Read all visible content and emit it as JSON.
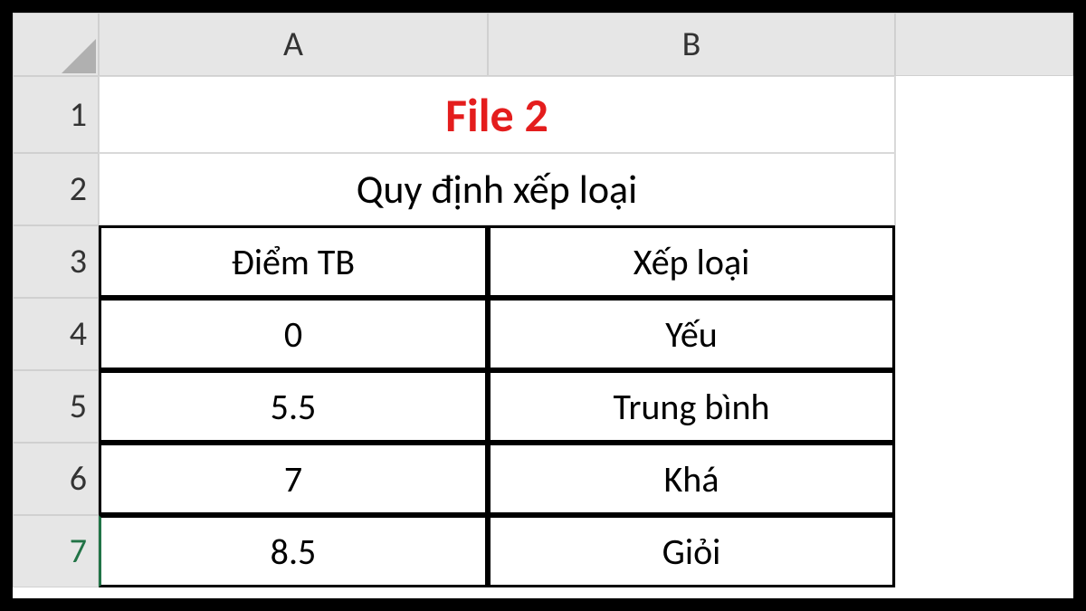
{
  "columns": {
    "a": "A",
    "b": "B"
  },
  "rows": {
    "r1": "1",
    "r2": "2",
    "r3": "3",
    "r4": "4",
    "r5": "5",
    "r6": "6",
    "r7": "7"
  },
  "title": "File 2",
  "subtitle": "Quy định xếp loại",
  "headers": {
    "col_a": "Điểm TB",
    "col_b": "Xếp loại"
  },
  "data": [
    {
      "a": "0",
      "b": "Yếu"
    },
    {
      "a": "5.5",
      "b": "Trung bình"
    },
    {
      "a": "7",
      "b": "Khá"
    },
    {
      "a": "8.5",
      "b": "Giỏi"
    }
  ]
}
